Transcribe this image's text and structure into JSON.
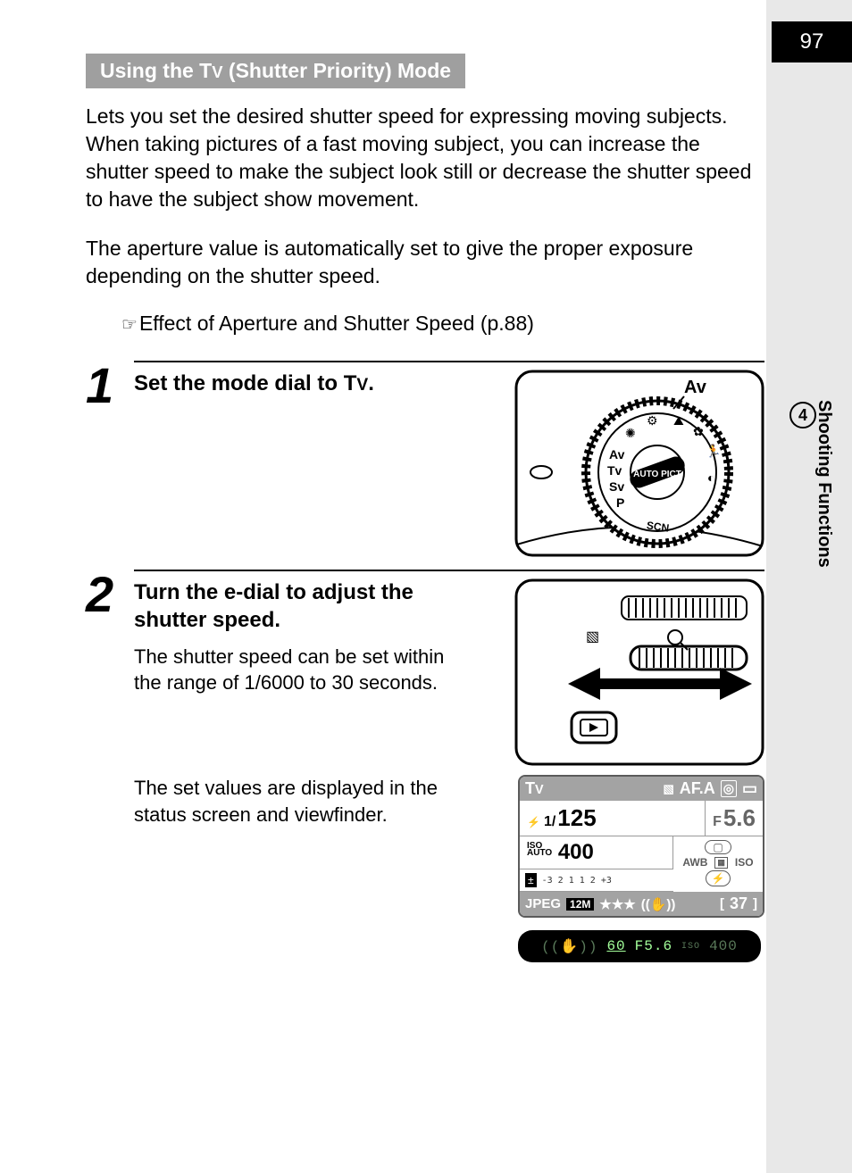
{
  "page_number": "97",
  "side_tab": {
    "chapter_number": "4",
    "label": "Shooting Functions"
  },
  "section_title_parts": {
    "before": "Using the ",
    "mode": "Tv",
    "after": " (Shutter Priority) Mode"
  },
  "intro_p1": "Lets you set the desired shutter speed for expressing moving subjects. When taking pictures of a fast moving subject, you can increase the shutter speed to make the subject look still or decrease the shutter speed to have the subject show movement.",
  "intro_p2": "The aperture value is automatically set to give the proper exposure depending on the shutter speed.",
  "cross_ref": "Effect of Aperture and Shutter Speed (p.88)",
  "steps": [
    {
      "num": "1",
      "title_before": "Set the mode dial to ",
      "title_mode": "Tv",
      "title_after": ".",
      "dial_label": "Av",
      "dial_marks": [
        "Av",
        "Tv",
        "Sv",
        "P",
        "SCN",
        "AUTO PICT"
      ]
    },
    {
      "num": "2",
      "title": "Turn the e-dial to adjust the shutter speed.",
      "body1": "The shutter speed can be set within the range of 1/6000 to 30 seconds.",
      "body2": "The set values are displayed in the status screen and viewfinder."
    }
  ],
  "status_screen": {
    "mode": "Tv",
    "af": "AF.A",
    "shutter_prefix": "1/",
    "shutter": "125",
    "aperture_prefix": "F",
    "aperture": "5.6",
    "iso_label_top": "ISO",
    "iso_label_bot": "AUTO",
    "iso": "400",
    "awb": "AWB",
    "iso_right": "ISO",
    "ev_scale": "-3  2  1     1  2  +3",
    "format": "JPEG",
    "mp": "12M",
    "stars": "★★★",
    "shots_open": "[",
    "shots": "37",
    "shots_close": "]"
  },
  "viewfinder": {
    "shutter": "60",
    "aperture": "F5.6",
    "iso_label": "ISO",
    "iso": "400"
  }
}
